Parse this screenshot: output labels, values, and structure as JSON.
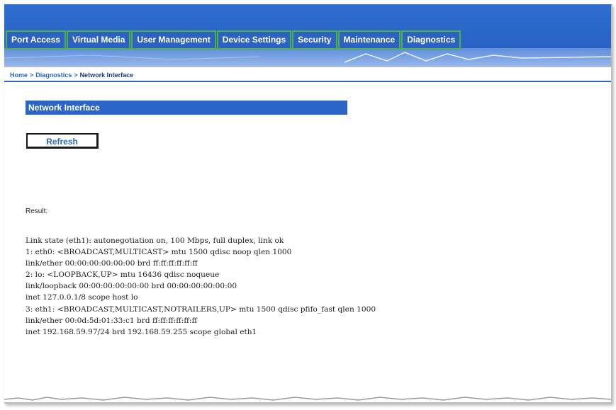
{
  "nav": {
    "tabs": [
      {
        "label": "Port Access"
      },
      {
        "label": "Virtual Media"
      },
      {
        "label": "User Management"
      },
      {
        "label": "Device Settings"
      },
      {
        "label": "Security"
      },
      {
        "label": "Maintenance"
      },
      {
        "label": "Diagnostics"
      }
    ]
  },
  "breadcrumb": {
    "home": "Home",
    "section": "Diagnostics",
    "current": "Network Interface",
    "separator": ">"
  },
  "panel": {
    "title": "Network Interface"
  },
  "actions": {
    "refresh_label": "Refresh"
  },
  "result": {
    "label": "Result:",
    "lines": [
      "Link state (eth1): autonegotiation on, 100 Mbps, full duplex, link ok",
      "1: eth0: <BROADCAST,MULTICAST> mtu 1500 qdisc noop qlen 1000",
      "link/ether 00:00:00:00:00:00 brd ff:ff:ff:ff:ff:ff",
      "2: lo: <LOOPBACK,UP> mtu 16436 qdisc noqueue",
      "link/loopback 00:00:00:00:00:00 brd 00:00:00:00:00:00",
      "inet 127.0.0.1/8 scope host lo",
      "3: eth1: <BROADCAST,MULTICAST,NOTRAILERS,UP> mtu 1500 qdisc pfifo_fast qlen 1000",
      "link/ether 00:0d:5d:01:33:c1 brd ff:ff:ff:ff:ff:ff",
      "inet 192.168.59.97/24 brd 192.168.59.255 scope global eth1"
    ]
  },
  "colors": {
    "header_blue": "#2a67c7",
    "tab_border": "#4fb04a",
    "link_blue": "#2b66c6"
  }
}
